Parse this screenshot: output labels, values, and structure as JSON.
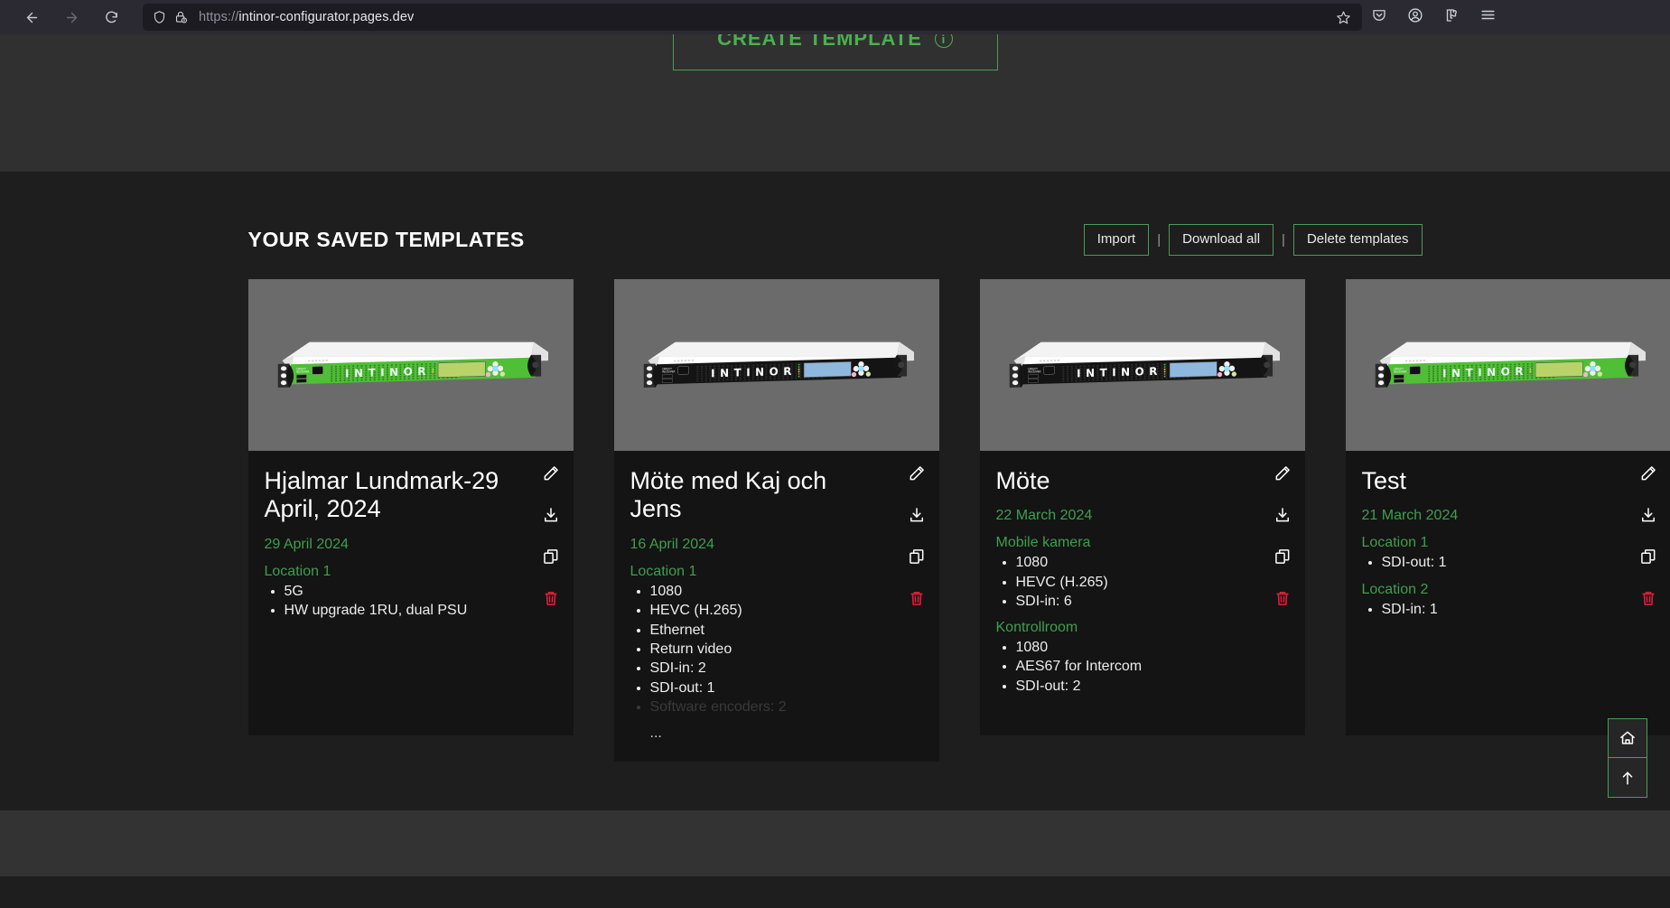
{
  "browser": {
    "back_icon": "arrow-left-icon",
    "forward_icon": "arrow-right-icon",
    "reload_icon": "reload-icon",
    "shield_icon": "shield-icon",
    "lock_warning_icon": "lock-warning-icon",
    "url_scheme": "https://",
    "url_host": "intinor-configurator.pages.dev",
    "bookmark_icon": "star-icon",
    "pocket_icon": "pocket-icon",
    "account_icon": "account-icon",
    "extensions_icon": "extensions-icon",
    "menu_icon": "hamburger-menu-icon"
  },
  "top": {
    "create_template_label": "CREATE TEMPLATE",
    "create_template_info_icon": "info-circle-icon"
  },
  "section": {
    "title": "YOUR SAVED TEMPLATES",
    "actions": {
      "import": "Import",
      "separator": "|",
      "download_all": "Download all",
      "delete_templates": "Delete templates"
    }
  },
  "card_icons": {
    "edit": "pencil-icon",
    "download": "download-icon",
    "duplicate": "copy-icon",
    "delete": "trash-icon"
  },
  "colors": {
    "accent_green": "#4caf50",
    "border_green": "#4c9a5a",
    "text_green": "#3f9e4f",
    "delete_red": "#e11d3a",
    "page_bg": "#1e1e1e",
    "top_bg": "#303030",
    "card_bg": "#141414",
    "image_bg": "#6b6b6b",
    "footer_bg": "#333333"
  },
  "cards": [
    {
      "title": "Hjalmar Lundmark-29 April, 2024",
      "date": "29 April 2024",
      "device_variant": "green",
      "locations": [
        {
          "name": "Location 1",
          "items": [
            "5G",
            "HW upgrade 1RU, dual PSU"
          ]
        }
      ],
      "truncated_item": null,
      "ellipsis": null
    },
    {
      "title": "Möte med Kaj och Jens",
      "date": "16 April 2024",
      "device_variant": "black",
      "locations": [
        {
          "name": "Location 1",
          "items": [
            "1080",
            "HEVC (H.265)",
            "Ethernet",
            "Return video",
            "SDI-in: 2",
            "SDI-out: 1"
          ]
        }
      ],
      "truncated_item": "Software encoders: 2",
      "ellipsis": "..."
    },
    {
      "title": "Möte",
      "date": "22 March 2024",
      "device_variant": "black",
      "locations": [
        {
          "name": "Mobile kamera",
          "items": [
            "1080",
            "HEVC (H.265)",
            "SDI-in: 6"
          ]
        },
        {
          "name": "Kontrollroom",
          "items": [
            "1080",
            "AES67 for Intercom",
            "SDI-out: 2"
          ]
        }
      ],
      "truncated_item": null,
      "ellipsis": null
    },
    {
      "title": "Test",
      "date": "21 March 2024",
      "device_variant": "green",
      "locations": [
        {
          "name": "Location 1",
          "items": [
            "SDI-out: 1"
          ]
        },
        {
          "name": "Location 2",
          "items": [
            "SDI-in: 1"
          ]
        }
      ],
      "truncated_item": null,
      "ellipsis": null
    }
  ],
  "float_buttons": {
    "home_icon": "home-icon",
    "scroll_top_icon": "arrow-up-icon"
  }
}
